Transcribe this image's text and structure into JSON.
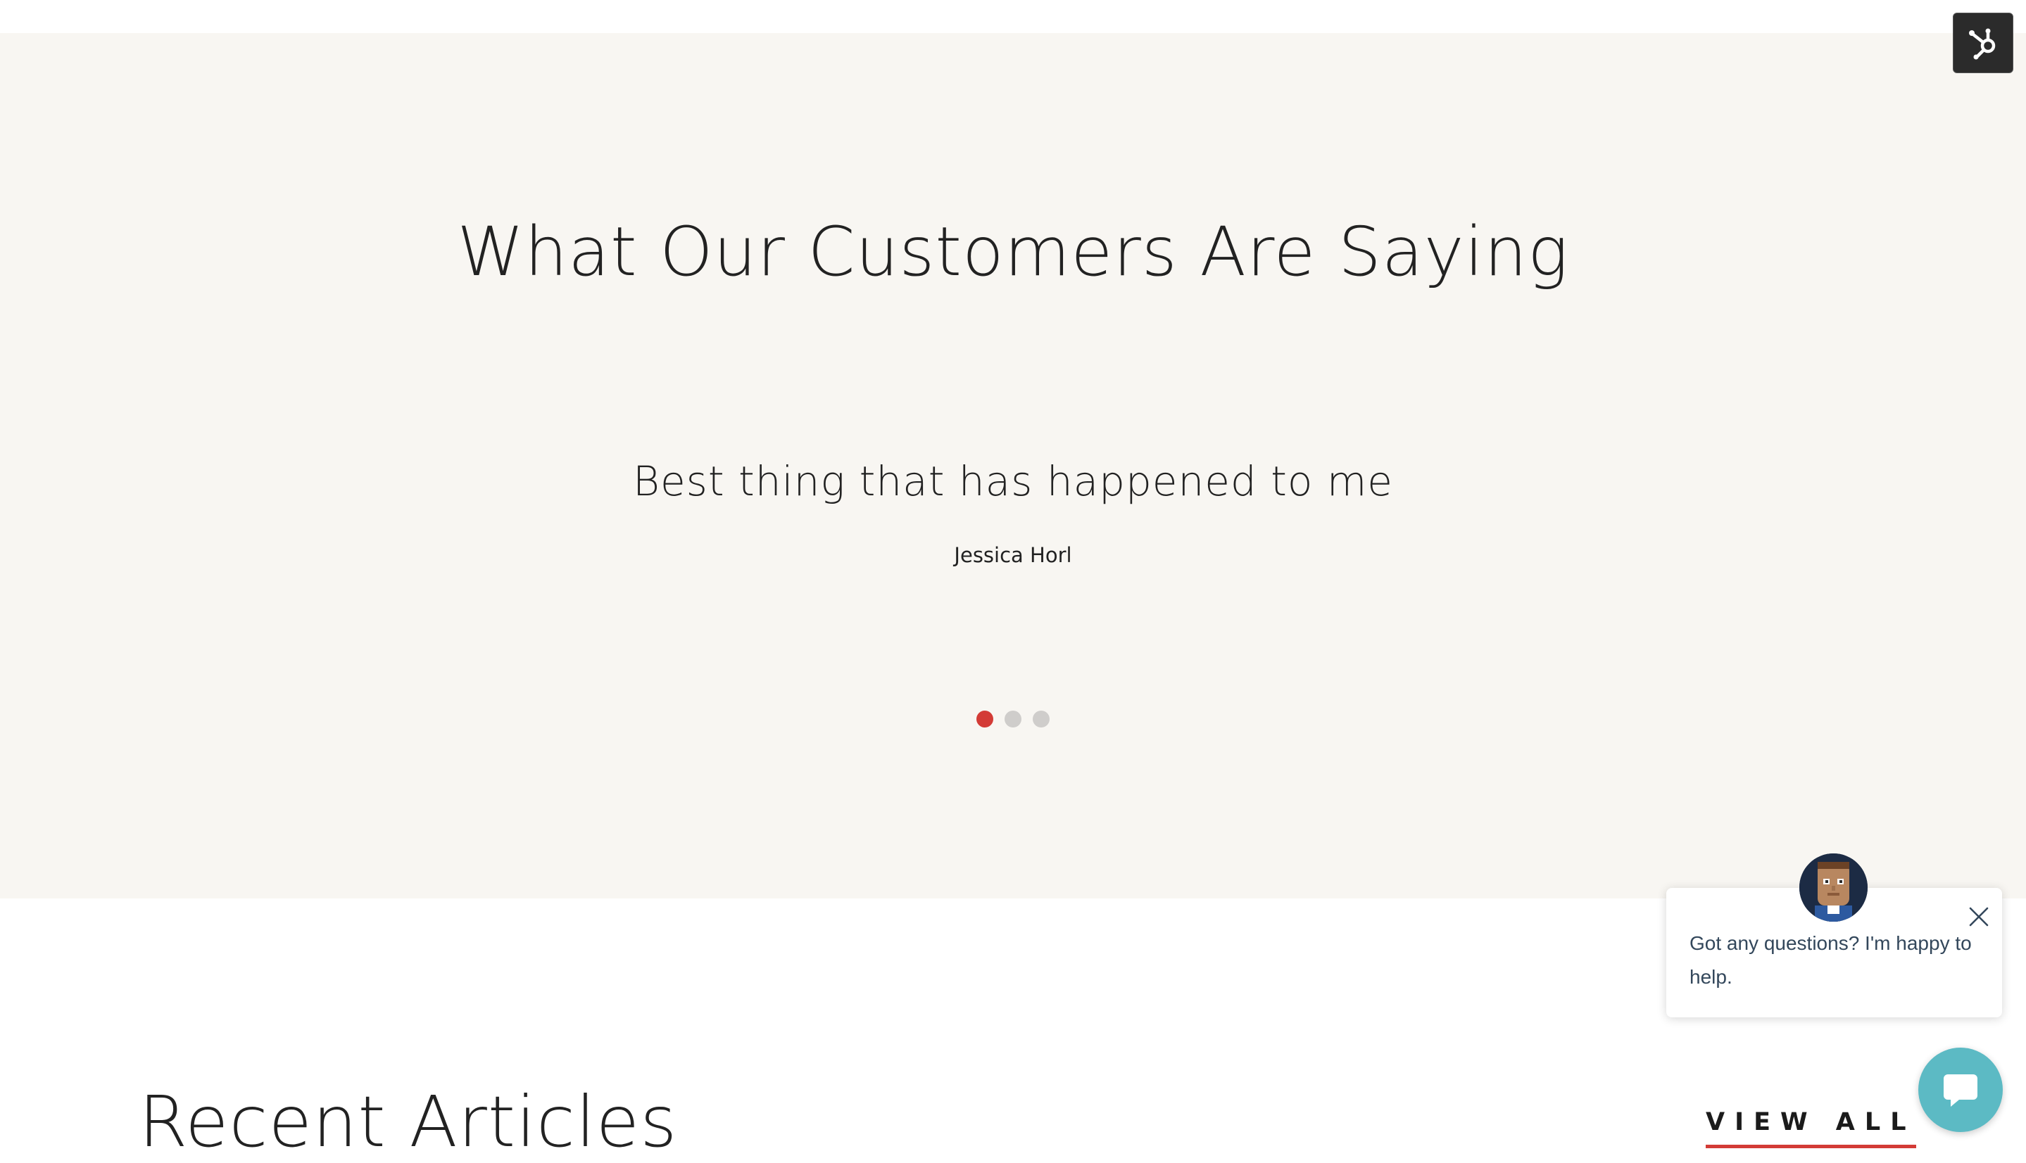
{
  "testimonials": {
    "title": "What Our Customers Are Saying",
    "quote": "Best thing that has happened to me",
    "author": "Jessica Horl",
    "slide_count": 3,
    "active_slide": 1
  },
  "recent_articles": {
    "title": "Recent Articles",
    "view_all_label": "VIEW ALL"
  },
  "chat": {
    "message": "Got any questions? I'm happy to help.",
    "close_icon": "close-icon",
    "launcher_icon": "chat-bubble-icon"
  },
  "hubspot_badge_icon": "hubspot-sprocket-icon",
  "colors": {
    "testimonial_bg": "#f8f6f2",
    "accent_red": "#d33b36",
    "inactive_dot": "#cfcdcb",
    "chat_launcher": "#5cbac4",
    "chat_text": "#33475b",
    "badge_bg": "#2b2b2b"
  }
}
